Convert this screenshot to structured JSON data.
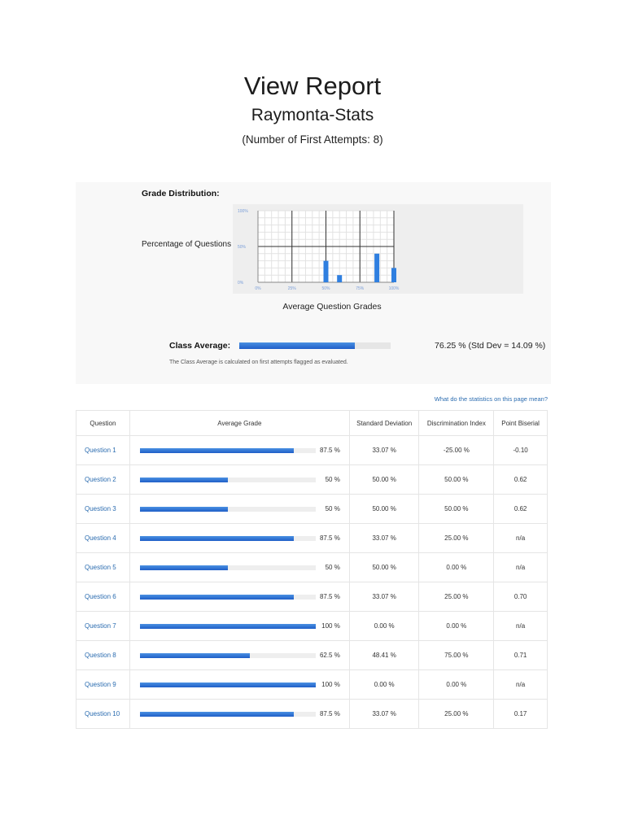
{
  "header": {
    "title": "View Report",
    "subtitle": "Raymonta-Stats",
    "attempts": "(Number of First Attempts: 8)"
  },
  "chart_data": {
    "type": "bar",
    "title": "Grade Distribution:",
    "ylabel": "Percentage of Questions",
    "xlabel": "Average Question Grades",
    "x_ticks": [
      "0%",
      "25%",
      "50%",
      "75%",
      "100%"
    ],
    "y_ticks": [
      "100%",
      "50%",
      "0%"
    ],
    "xlim": [
      0,
      100
    ],
    "ylim": [
      0,
      100
    ],
    "x": [
      50,
      60,
      87.5,
      100
    ],
    "values": [
      30,
      10,
      40,
      20
    ],
    "grid": true,
    "bar_color": "#2f7fe0"
  },
  "class_average": {
    "label": "Class Average:",
    "value_fraction": 0.7625,
    "text": "76.25 % (Std Dev = 14.09 %)",
    "note": "The Class Average is calculated on first attempts flagged as evaluated."
  },
  "help_link": "What do the statistics on this page mean?",
  "table": {
    "headers": [
      "Question",
      "Average Grade",
      "Standard Deviation",
      "Discrimination Index",
      "Point Biserial"
    ],
    "rows": [
      {
        "question": "Question 1",
        "grade": 87.5,
        "grade_text": "87.5 %",
        "std": "33.07 %",
        "disc": "-25.00 %",
        "pb": "-0.10"
      },
      {
        "question": "Question 2",
        "grade": 50,
        "grade_text": "50 %",
        "std": "50.00 %",
        "disc": "50.00 %",
        "pb": "0.62"
      },
      {
        "question": "Question 3",
        "grade": 50,
        "grade_text": "50 %",
        "std": "50.00 %",
        "disc": "50.00 %",
        "pb": "0.62"
      },
      {
        "question": "Question 4",
        "grade": 87.5,
        "grade_text": "87.5 %",
        "std": "33.07 %",
        "disc": "25.00 %",
        "pb": "n/a"
      },
      {
        "question": "Question 5",
        "grade": 50,
        "grade_text": "50 %",
        "std": "50.00 %",
        "disc": "0.00 %",
        "pb": "n/a"
      },
      {
        "question": "Question 6",
        "grade": 87.5,
        "grade_text": "87.5 %",
        "std": "33.07 %",
        "disc": "25.00 %",
        "pb": "0.70"
      },
      {
        "question": "Question 7",
        "grade": 100,
        "grade_text": "100 %",
        "std": "0.00 %",
        "disc": "0.00 %",
        "pb": "n/a"
      },
      {
        "question": "Question 8",
        "grade": 62.5,
        "grade_text": "62.5 %",
        "std": "48.41 %",
        "disc": "75.00 %",
        "pb": "0.71"
      },
      {
        "question": "Question 9",
        "grade": 100,
        "grade_text": "100 %",
        "std": "0.00 %",
        "disc": "0.00 %",
        "pb": "n/a"
      },
      {
        "question": "Question 10",
        "grade": 87.5,
        "grade_text": "87.5 %",
        "std": "33.07 %",
        "disc": "25.00 %",
        "pb": "0.17"
      }
    ]
  }
}
